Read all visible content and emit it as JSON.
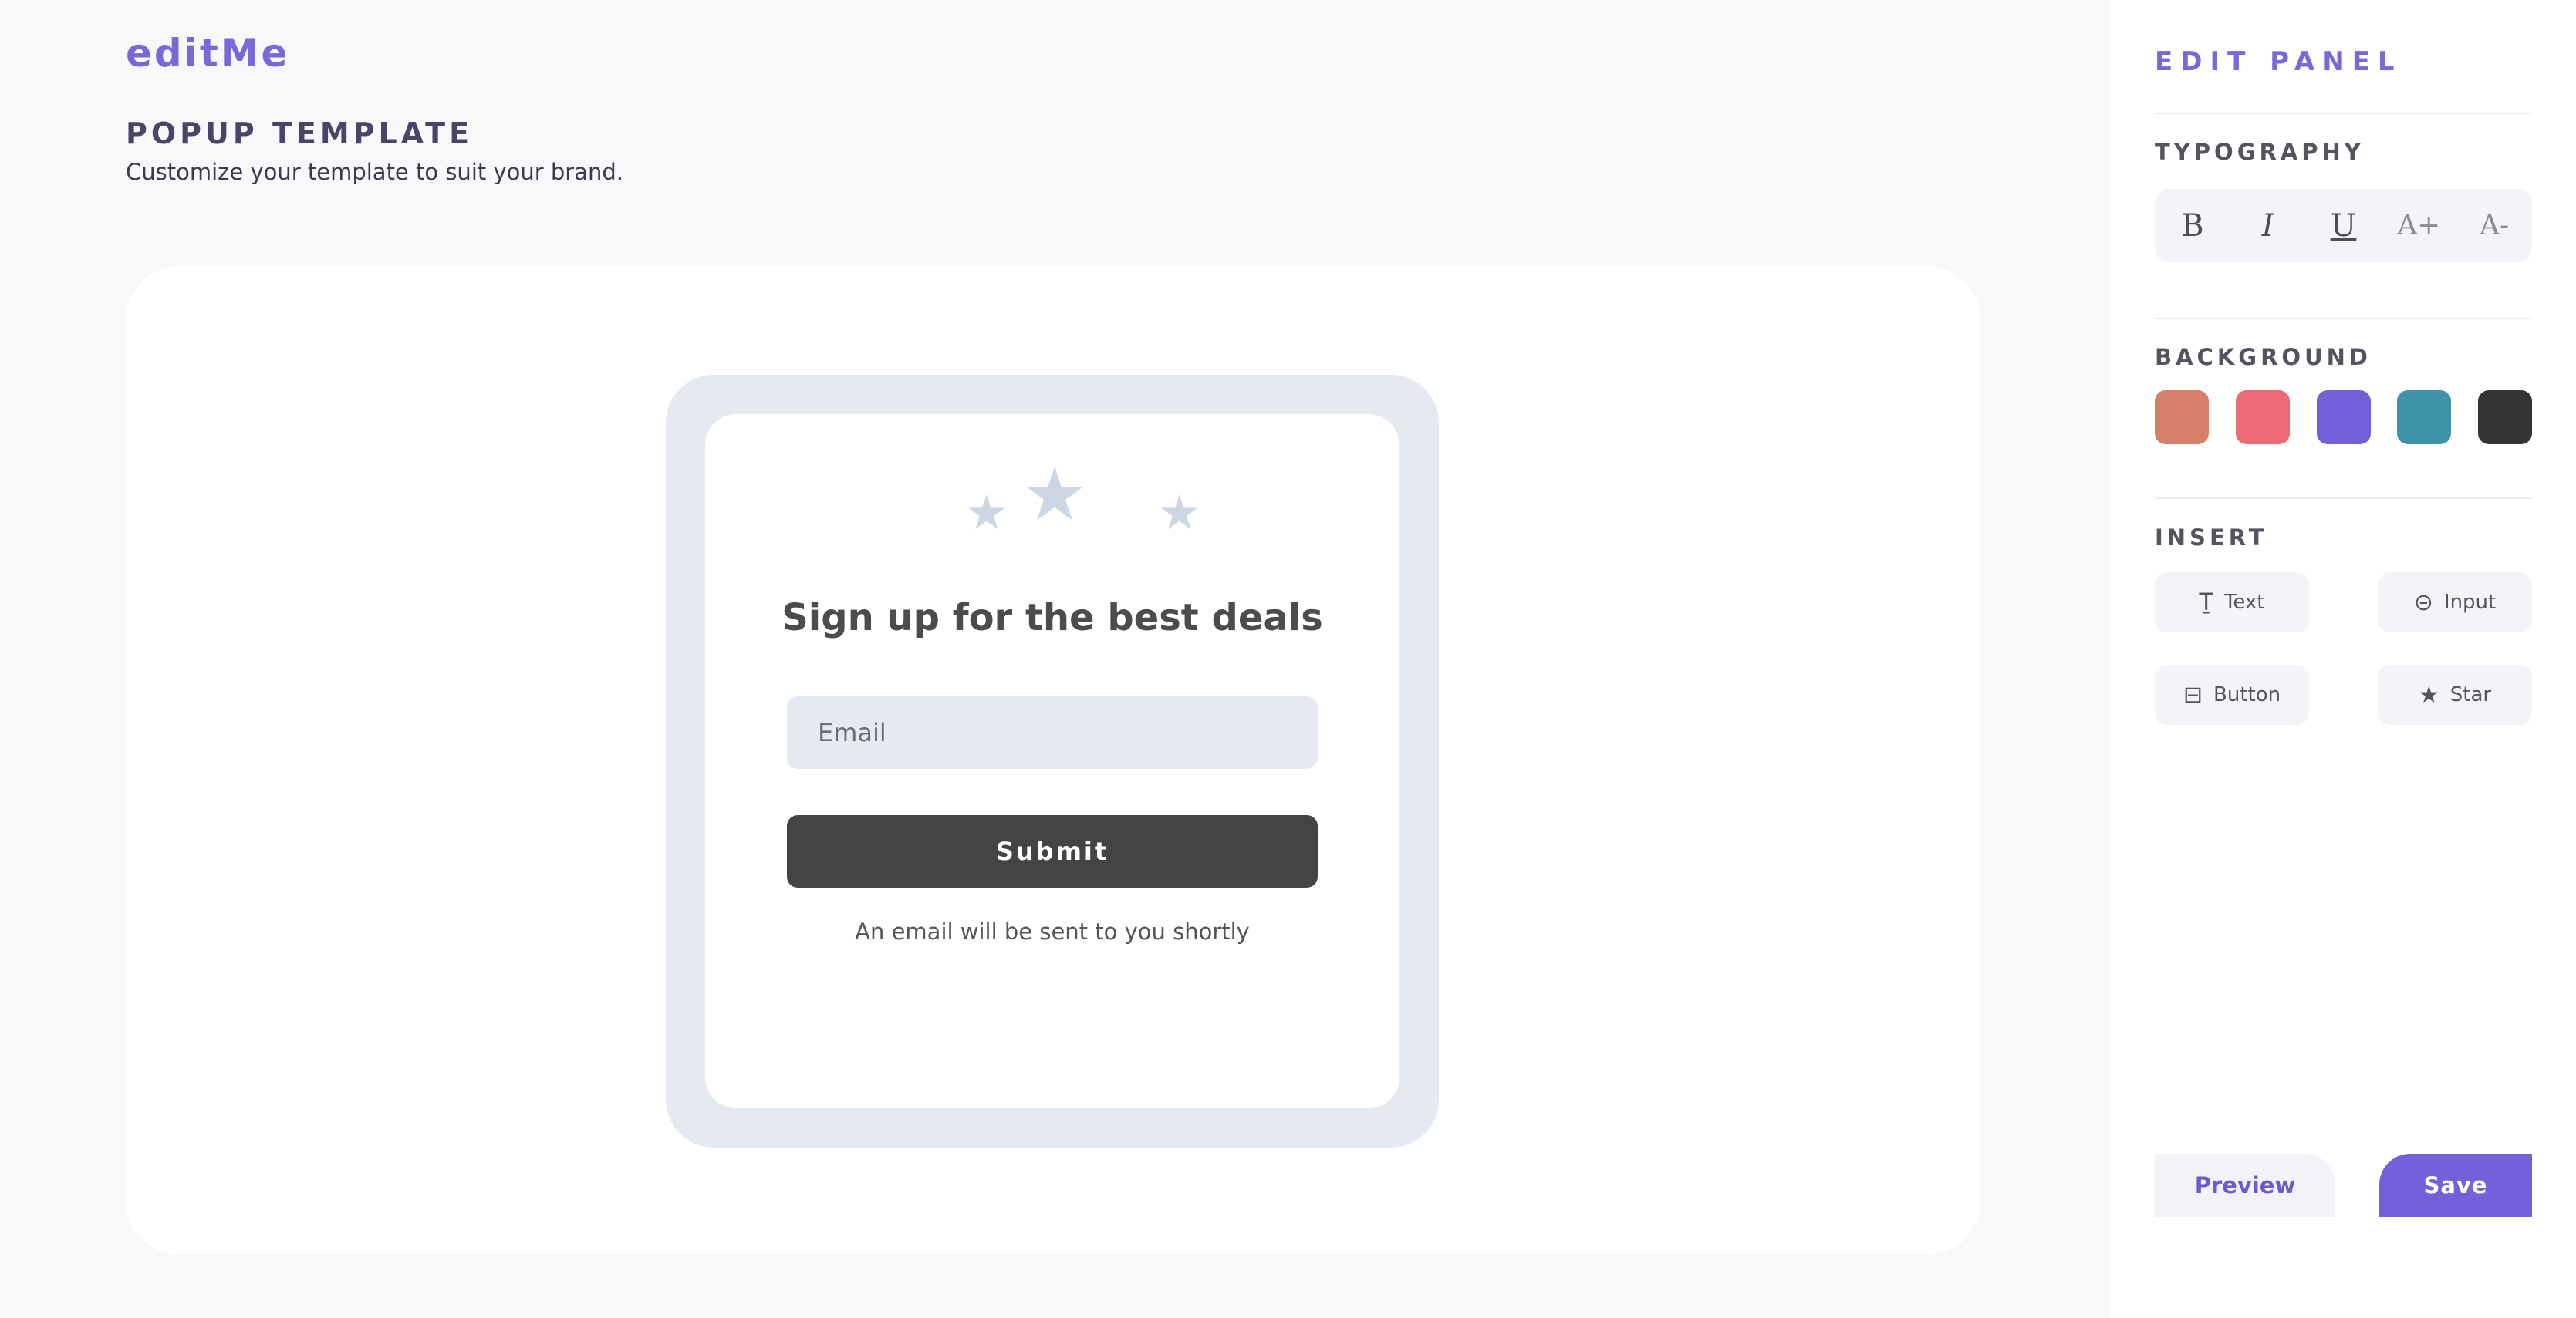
{
  "app": {
    "logo": "editMe"
  },
  "header": {
    "title": "POPUP TEMPLATE",
    "subtitle": "Customize your template to suit your brand."
  },
  "popup": {
    "heading": "Sign up for the best deals",
    "email_placeholder": "Email",
    "submit_label": "Submit",
    "note": "An email will be sent to you shortly",
    "star_icon": "star-icon",
    "star_color": "#cdd7e3"
  },
  "panel": {
    "title": "EDIT PANEL",
    "typography": {
      "label": "TYPOGRAPHY",
      "buttons": [
        {
          "name": "bold",
          "glyph": "B"
        },
        {
          "name": "italic",
          "glyph": "I"
        },
        {
          "name": "underline",
          "glyph": "U"
        },
        {
          "name": "font-size-increase",
          "glyph": "A+"
        },
        {
          "name": "font-size-decrease",
          "glyph": "A-"
        }
      ]
    },
    "background": {
      "label": "BACKGROUND",
      "swatches": [
        "#d4806a",
        "#ec6a78",
        "#7260d8",
        "#3f93a8",
        "#343434"
      ]
    },
    "insert": {
      "label": "INSERT",
      "items": [
        {
          "label": "Text",
          "icon": "text-icon"
        },
        {
          "label": "Input",
          "icon": "input-icon"
        },
        {
          "label": "Button",
          "icon": "button-icon"
        },
        {
          "label": "Star",
          "icon": "star-icon"
        }
      ]
    },
    "preview_label": "Preview",
    "save_label": "Save"
  },
  "colors": {
    "accent": "#7261d8",
    "background": "#f8f8fb",
    "submit": "#444444"
  }
}
